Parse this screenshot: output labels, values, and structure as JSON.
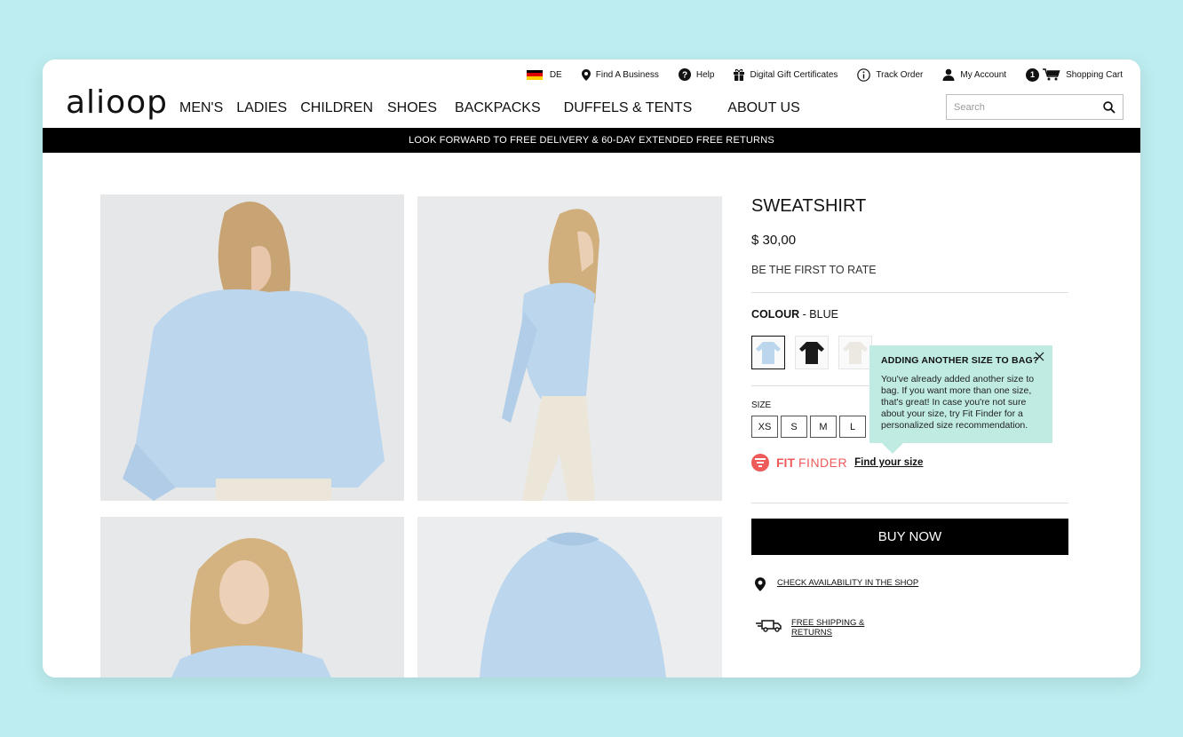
{
  "utility": {
    "country": "DE",
    "find_business": "Find A Business",
    "help": "Help",
    "gift": "Digital Gift Certificates",
    "track": "Track Order",
    "account": "My Account",
    "cart_count": "1",
    "cart": "Shopping Cart"
  },
  "header": {
    "logo": "alioop",
    "nav": [
      "MEN'S",
      "LADIES",
      "CHILDREN",
      "SHOES",
      "BACKPACKS",
      "DUFFELS & TENTS",
      "ABOUT US"
    ],
    "search_placeholder": "Search"
  },
  "banner": "LOOK FORWARD TO FREE DELIVERY & 60-DAY EXTENDED FREE RETURNS",
  "product": {
    "title": "SWEATSHIRT",
    "price": "$ 30,00",
    "rating": "BE THE FIRST TO RATE",
    "colour_label": "COLOUR",
    "colour_value": " - BLUE",
    "swatches": [
      {
        "name": "blue",
        "color": "#bcd6ee"
      },
      {
        "name": "black",
        "color": "#1a1a1a"
      },
      {
        "name": "white",
        "color": "#f0efe9"
      }
    ],
    "size_label": "SIZE",
    "sizes": [
      "XS",
      "S",
      "M",
      "L"
    ],
    "fit_finder": {
      "fit": "FIT",
      "finder": "FINDER",
      "link": "Find your size"
    },
    "buy": "BUY NOW",
    "check_availability": "CHECK AVAILABILITY IN THE SHOP",
    "shipping_line1": "FREE SHIPPING &",
    "shipping_line2": "RETURNS"
  },
  "tooltip": {
    "title": "ADDING ANOTHER SIZE TO BAG?",
    "body": "You've already added another size to bag. If you want more than one size, that's great! In case you're not sure about your size, try Fit Finder for a personalized size recommendation."
  },
  "colors": {
    "page_bg": "#bdedf0",
    "sweater": "#bcd6ee",
    "tooltip_bg": "#bfebe3",
    "fit_finder": "#ef5a5a"
  }
}
